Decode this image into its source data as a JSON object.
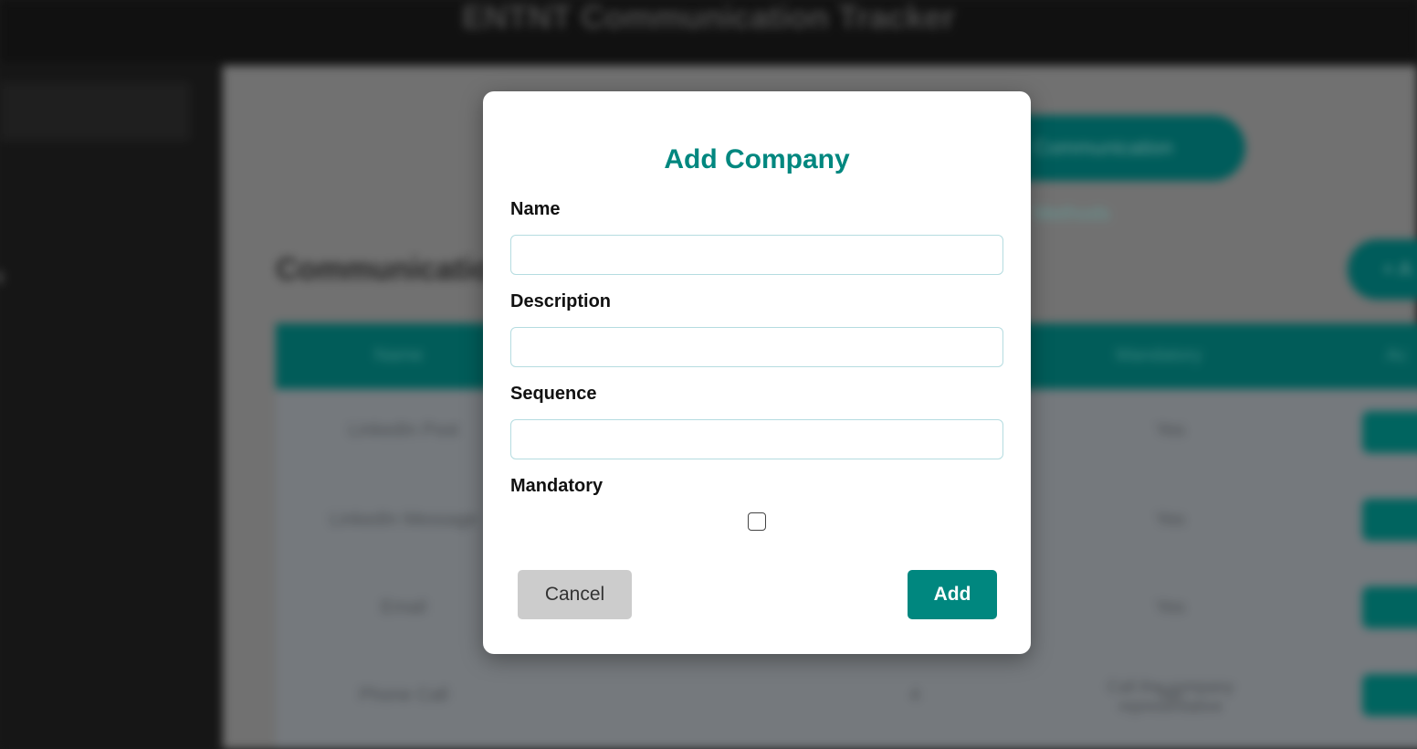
{
  "app": {
    "title": "ENTNT Communication Tracker",
    "sidebar_item": "s",
    "top_button": "Communication Methods",
    "add_button": "+ A",
    "section_title": "Communication",
    "table": {
      "headers": [
        "Name",
        "Mandatory",
        "Ac"
      ],
      "rows": [
        {
          "name": "LinkedIn Post",
          "mandatory": "Yes"
        },
        {
          "name": "LinkedIn Message",
          "mandatory": "Yes"
        },
        {
          "name": "Email",
          "mandatory": "Yes"
        },
        {
          "name": "Phone Call",
          "description": "Call the company representative",
          "sequence": "4",
          "mandatory": "No"
        }
      ]
    }
  },
  "modal": {
    "title": "Add Company",
    "fields": {
      "name": {
        "label": "Name",
        "value": "",
        "placeholder": ""
      },
      "description": {
        "label": "Description",
        "value": "",
        "placeholder": ""
      },
      "sequence": {
        "label": "Sequence",
        "value": "",
        "placeholder": ""
      }
    },
    "mandatory": {
      "label": "Mandatory",
      "checked": false
    },
    "cancel_label": "Cancel",
    "add_label": "Add"
  },
  "colors": {
    "accent": "#00877f",
    "cancel_bg": "#cccccc",
    "input_border": "#b5dce0"
  },
  "icons": {
    "edit": "pencil-icon"
  }
}
